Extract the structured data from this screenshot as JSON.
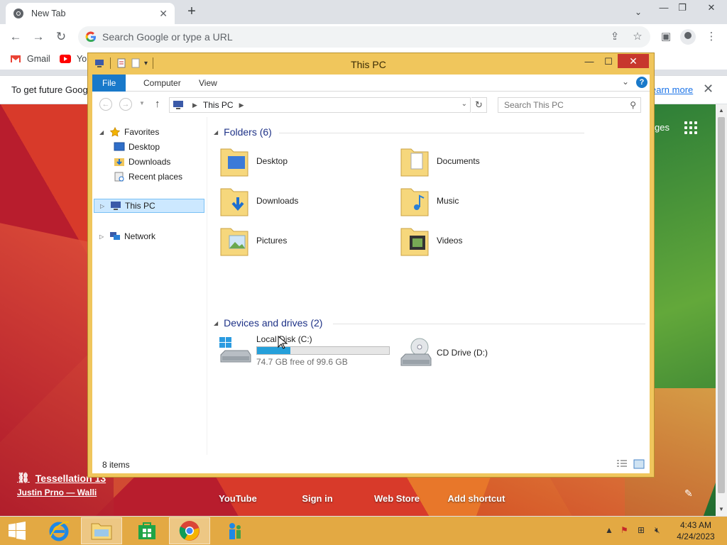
{
  "chrome": {
    "tab_title": "New Tab",
    "omnibox_placeholder": "Search Google or type a URL",
    "bookmarks": [
      {
        "label": "Gmail"
      },
      {
        "label": "Yo"
      }
    ],
    "infobar_text": "To get future Goog",
    "infobar_link": "earn more",
    "ntp": {
      "pages_text": "ges",
      "shortcuts": [
        {
          "label": "YouTube"
        },
        {
          "label": "Sign in"
        },
        {
          "label": "Web Store"
        },
        {
          "label": "Add shortcut"
        }
      ],
      "theme_name": "Tessellation 13",
      "theme_author": "Justin Prno — Walli"
    }
  },
  "explorer": {
    "title": "This PC",
    "ribbon_tabs": [
      {
        "label": "File"
      },
      {
        "label": "Computer"
      },
      {
        "label": "View"
      }
    ],
    "address": {
      "crumb": "This PC",
      "search_placeholder": "Search This PC"
    },
    "nav_pane": {
      "favorites": "Favorites",
      "favorite_items": [
        {
          "label": "Desktop"
        },
        {
          "label": "Downloads"
        },
        {
          "label": "Recent places"
        }
      ],
      "this_pc": "This PC",
      "network": "Network"
    },
    "folders_header": "Folders (6)",
    "folders": [
      {
        "label": "Desktop"
      },
      {
        "label": "Documents"
      },
      {
        "label": "Downloads"
      },
      {
        "label": "Music"
      },
      {
        "label": "Pictures"
      },
      {
        "label": "Videos"
      }
    ],
    "devices_header": "Devices and drives (2)",
    "drives": {
      "c_name": "Local Disk (C:)",
      "c_free": "74.7 GB free of 99.6 GB",
      "c_used_fraction": 0.25,
      "d_name": "CD Drive (D:)"
    },
    "status": "8 items"
  },
  "taskbar": {
    "time": "4:43 AM",
    "date": "4/24/2023"
  },
  "colors": {
    "explorer_frame": "#f0c65c",
    "ribbon_file": "#1979ca",
    "taskbar": "#e3a943",
    "drive_bar": "#26a0da"
  }
}
